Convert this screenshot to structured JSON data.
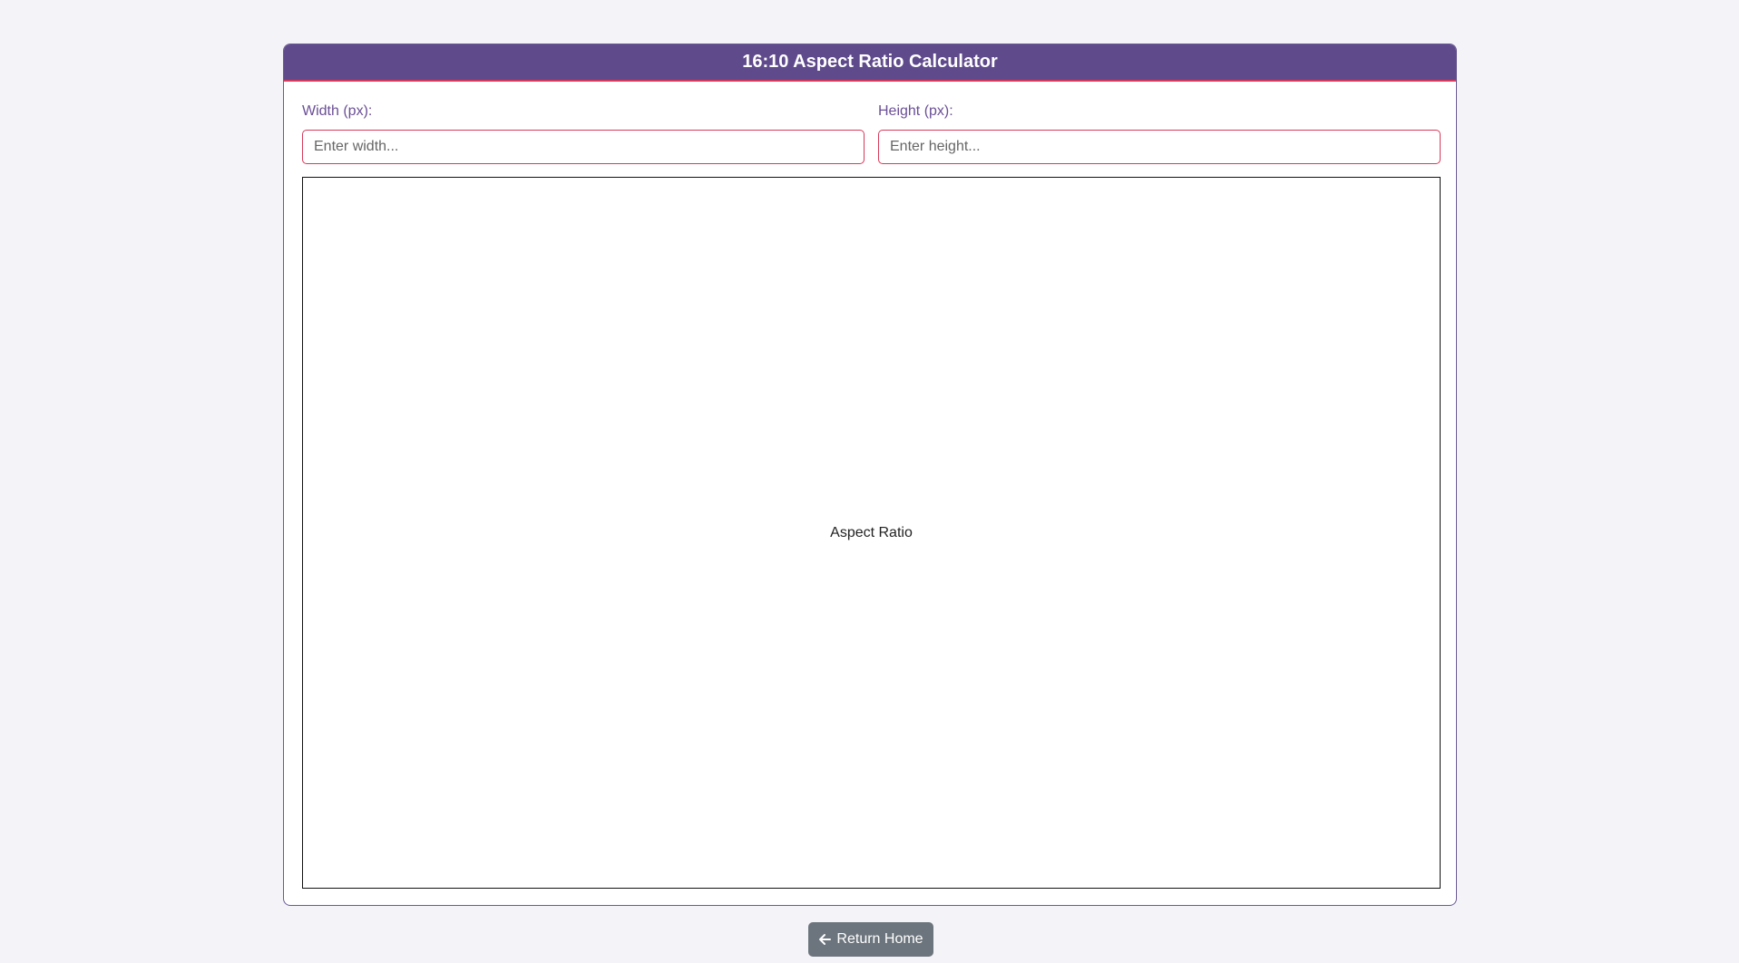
{
  "calculator": {
    "title": "16:10 Aspect Ratio Calculator",
    "width_label": "Width (px):",
    "width_placeholder": "Enter width...",
    "width_value": "",
    "height_label": "Height (px):",
    "height_placeholder": "Enter height...",
    "height_value": "",
    "preview_label": "Aspect Ratio"
  },
  "footer": {
    "return_home_label": "Return Home",
    "return_home_icon": "arrow-left-icon"
  },
  "colors": {
    "header_bg": "#5f4a8b",
    "accent_border": "#d63a5a",
    "label_text": "#6a4f96",
    "button_bg": "#6c757d",
    "page_bg": "#f3f3f8"
  }
}
